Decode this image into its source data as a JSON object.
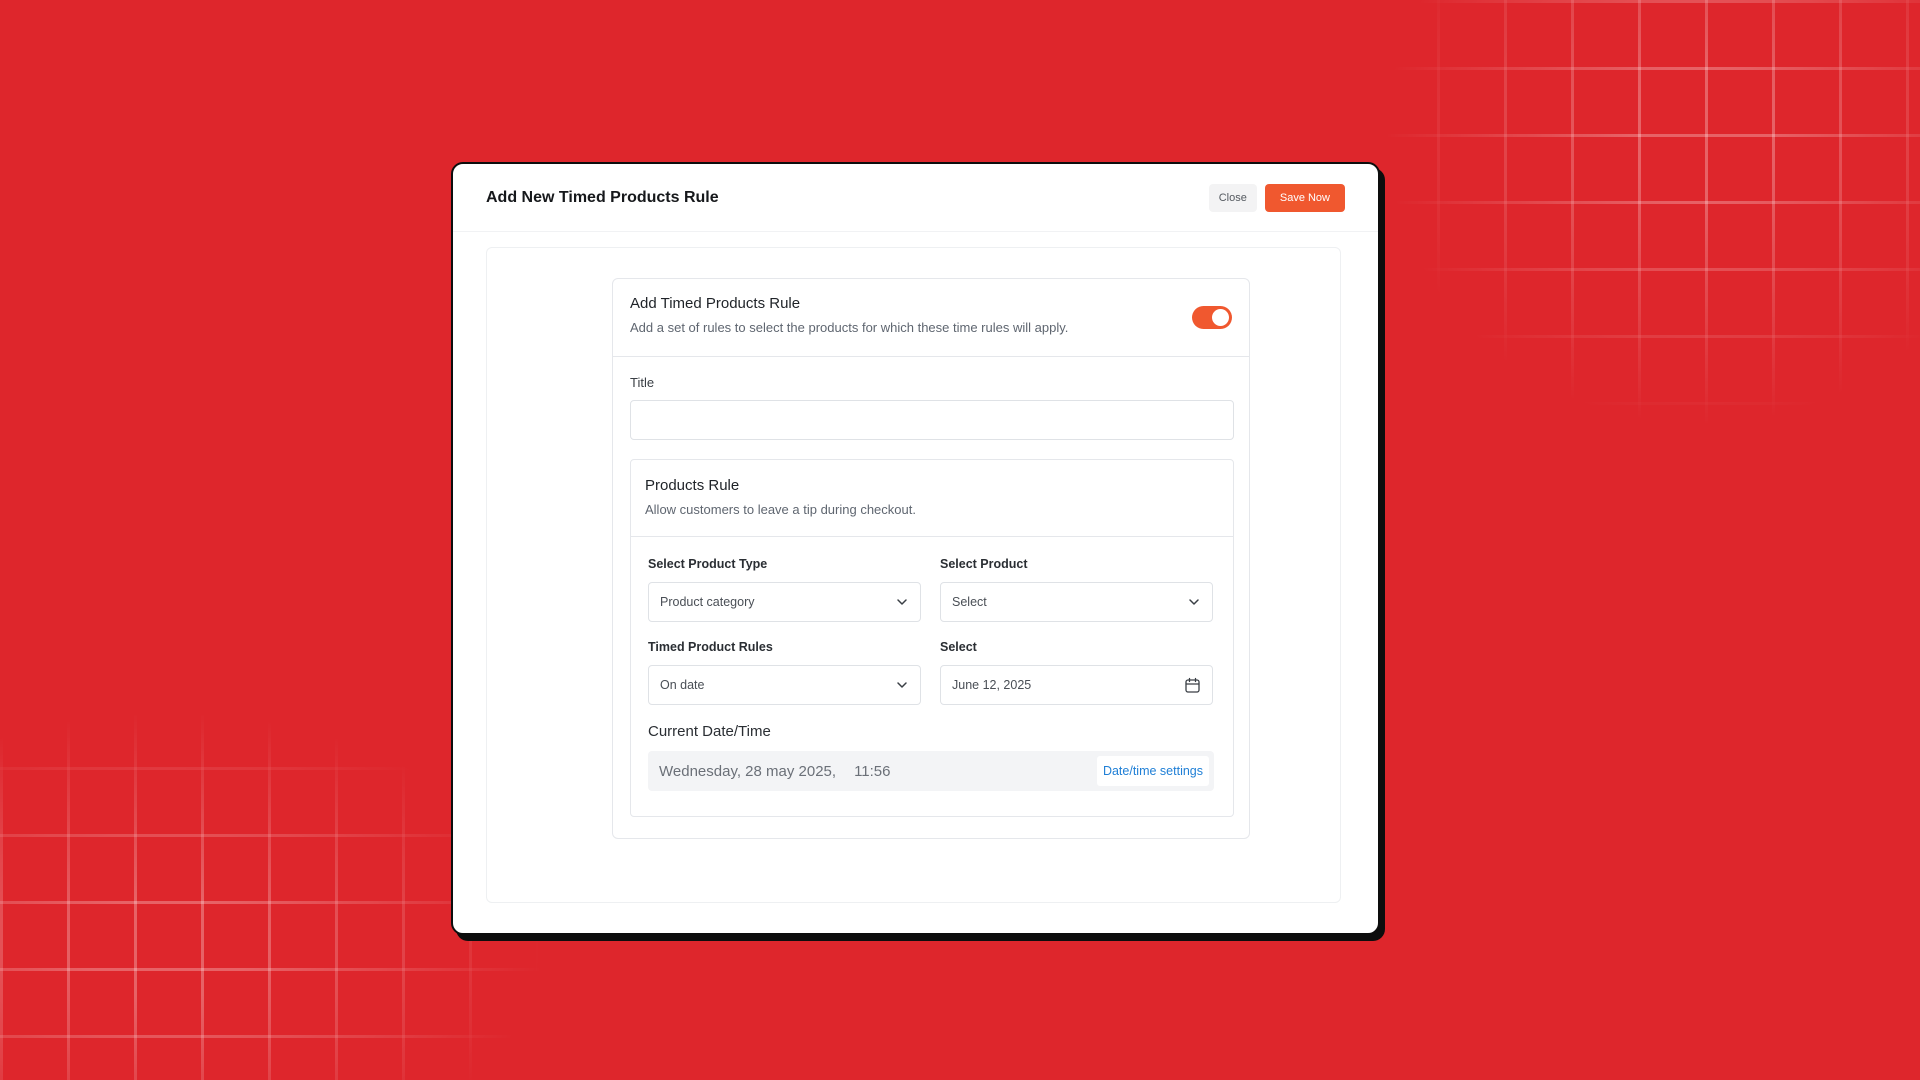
{
  "modal": {
    "title": "Add New Timed Products Rule",
    "close_label": "Close",
    "save_label": "Save Now"
  },
  "rule_card": {
    "title": "Add Timed Products Rule",
    "description": "Add a set of rules to select the products for which these  time rules will apply.",
    "enabled": true
  },
  "title_field": {
    "label": "Title",
    "value": ""
  },
  "products_rule": {
    "title": "Products Rule",
    "description": "Allow customers to leave a tip during checkout.",
    "product_type": {
      "label": "Select Product Type",
      "value": "Product category"
    },
    "product": {
      "label": "Select Product",
      "value": "Select"
    },
    "timed_rules": {
      "label": "Timed Product Rules",
      "value": "On date"
    },
    "date": {
      "label": "Select",
      "value": "June 12, 2025"
    },
    "current": {
      "label": "Current Date/Time",
      "date": "Wednesday, 28 may 2025,",
      "time": "11:56",
      "settings_label": "Date/time settings"
    }
  },
  "colors": {
    "background": "#de262c",
    "accent": "#f0582f",
    "link": "#1f7fd6"
  },
  "icons": {
    "dropdown": "chevron-down-icon",
    "date": "calendar-icon"
  }
}
